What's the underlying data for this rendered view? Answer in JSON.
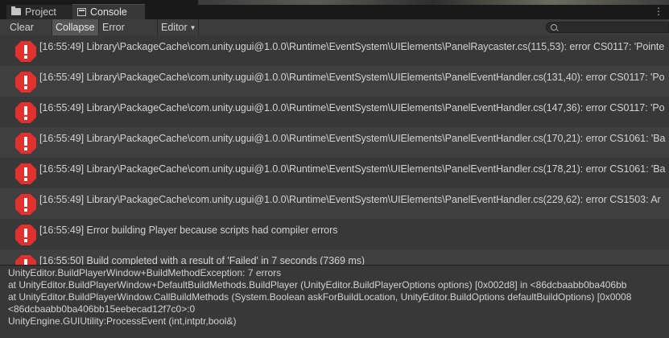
{
  "tabs": {
    "project_label": "Project",
    "console_label": "Console",
    "menu_glyph": "⋮"
  },
  "toolbar": {
    "clear_label": "Clear",
    "collapse_label": "Collapse",
    "error_pause_label": "Error Pause",
    "editor_label": "Editor",
    "search_placeholder": ""
  },
  "colors": {
    "error_icon": "#e0312f",
    "panel_bg": "#383838",
    "active_button": "#555555"
  },
  "log": {
    "entries": [
      {
        "icon": "error-icon",
        "text": "[16:55:49] Library\\PackageCache\\com.unity.ugui@1.0.0\\Runtime\\EventSystem\\UIElements\\PanelRaycaster.cs(115,53): error CS0117: 'Pointe"
      },
      {
        "icon": "error-icon",
        "text": "[16:55:49] Library\\PackageCache\\com.unity.ugui@1.0.0\\Runtime\\EventSystem\\UIElements\\PanelEventHandler.cs(131,40): error CS0117: 'Po"
      },
      {
        "icon": "error-icon",
        "text": "[16:55:49] Library\\PackageCache\\com.unity.ugui@1.0.0\\Runtime\\EventSystem\\UIElements\\PanelEventHandler.cs(147,36): error CS0117: 'Po"
      },
      {
        "icon": "error-icon",
        "text": "[16:55:49] Library\\PackageCache\\com.unity.ugui@1.0.0\\Runtime\\EventSystem\\UIElements\\PanelEventHandler.cs(170,21): error CS1061: 'Ba"
      },
      {
        "icon": "error-icon",
        "text": "[16:55:49] Library\\PackageCache\\com.unity.ugui@1.0.0\\Runtime\\EventSystem\\UIElements\\PanelEventHandler.cs(178,21): error CS1061: 'Ba"
      },
      {
        "icon": "error-icon",
        "text": "[16:55:49] Library\\PackageCache\\com.unity.ugui@1.0.0\\Runtime\\EventSystem\\UIElements\\PanelEventHandler.cs(229,62): error CS1503: Ar"
      },
      {
        "icon": "error-icon",
        "text": "[16:55:49] Error building Player because scripts had compiler errors"
      },
      {
        "icon": "error-icon",
        "text": "[16:55:50] Build completed with a result of 'Failed' in 7 seconds (7369 ms)"
      }
    ]
  },
  "detail": {
    "lines": [
      "UnityEditor.BuildPlayerWindow+BuildMethodException: 7 errors",
      "  at UnityEditor.BuildPlayerWindow+DefaultBuildMethods.BuildPlayer (UnityEditor.BuildPlayerOptions options) [0x002d8] in <86dcbaabb0ba406bb",
      "  at UnityEditor.BuildPlayerWindow.CallBuildMethods (System.Boolean askForBuildLocation, UnityEditor.BuildOptions defaultBuildOptions) [0x0008",
      "<86dcbaabb0ba406bb15eebecad12f7c0>:0",
      "UnityEngine.GUIUtility:ProcessEvent (int,intptr,bool&)"
    ]
  }
}
